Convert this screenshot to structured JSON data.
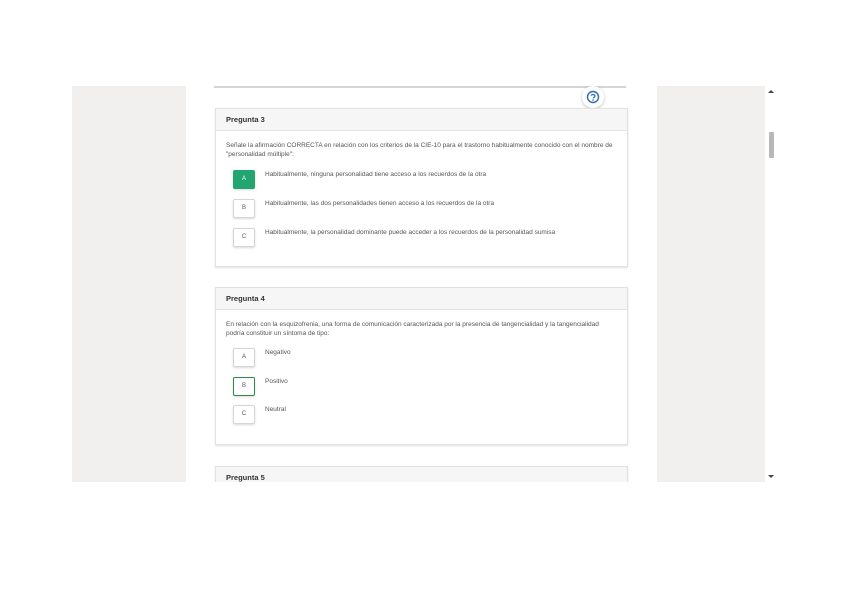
{
  "questions": [
    {
      "title": "Pregunta 3",
      "text": "Señale la afirmación CORRECTA en relación con los criterios de la CIE-10 para el trastorno habitualmente conocido con el nombre de \"personalidad múltiple\":",
      "options": [
        {
          "letter": "A",
          "text": "Habitualmente, ninguna personalidad tiene acceso a los recuerdos de la otra",
          "state": "selected"
        },
        {
          "letter": "B",
          "text": "Habitualmente, las dos personalidades tienen acceso a los recuerdos de la otra",
          "state": "none"
        },
        {
          "letter": "C",
          "text": "Habitualmente, la personalidad dominante puede acceder a los recuerdos de la personalidad sumisa",
          "state": "none"
        }
      ]
    },
    {
      "title": "Pregunta 4",
      "text": "En relación con la esquizofrenia, una forma de comunicación caracterizada por la presencia de tangencialidad y la tangencialidad podría constituir un síntoma de tipo:",
      "options": [
        {
          "letter": "A",
          "text": "Negativo",
          "state": "none"
        },
        {
          "letter": "B",
          "text": "Positivo",
          "state": "marked"
        },
        {
          "letter": "C",
          "text": "Neutral",
          "state": "none"
        }
      ]
    },
    {
      "title": "Pregunta 5"
    }
  ],
  "colors": {
    "selected_fill": "#21a671",
    "marked_outline": "#2e8b46",
    "chat_icon": "#2a6bb5"
  },
  "icons": {
    "floating": "chat-help-icon"
  }
}
